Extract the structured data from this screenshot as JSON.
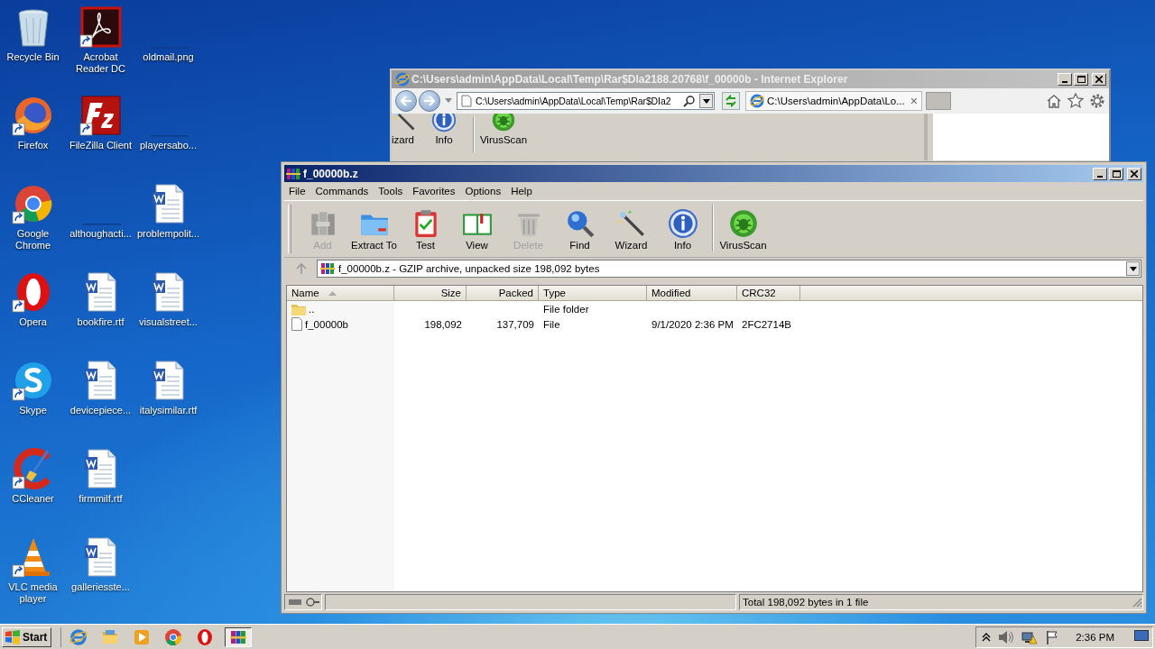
{
  "desktop": {
    "icons": [
      {
        "label": "Recycle Bin",
        "kind": "recycle",
        "shortcut": false
      },
      {
        "label": "Firefox",
        "kind": "firefox",
        "shortcut": true
      },
      {
        "label": "Google Chrome",
        "kind": "chrome",
        "shortcut": true
      },
      {
        "label": "Opera",
        "kind": "opera",
        "shortcut": true
      },
      {
        "label": "Skype",
        "kind": "skype",
        "shortcut": true
      },
      {
        "label": "CCleaner",
        "kind": "ccleaner",
        "shortcut": true
      },
      {
        "label": "VLC media player",
        "kind": "vlc",
        "shortcut": true
      },
      {
        "label": "Acrobat Reader DC",
        "kind": "acrobat",
        "shortcut": true
      },
      {
        "label": "FileZilla Client",
        "kind": "filezilla",
        "shortcut": true
      },
      {
        "label": "althoughacti...",
        "kind": "blank",
        "shortcut": false
      },
      {
        "label": "bookfire.rtf",
        "kind": "word",
        "shortcut": false
      },
      {
        "label": "devicepiece...",
        "kind": "word",
        "shortcut": false
      },
      {
        "label": "firmmilf.rtf",
        "kind": "word",
        "shortcut": false
      },
      {
        "label": "galleriesste...",
        "kind": "word",
        "shortcut": false
      },
      {
        "label": "oldmail.png",
        "kind": "blank",
        "shortcut": false
      },
      {
        "label": "playersabo...",
        "kind": "blank",
        "shortcut": false
      },
      {
        "label": "problempolit...",
        "kind": "word",
        "shortcut": false
      },
      {
        "label": "visualstreet...",
        "kind": "word",
        "shortcut": false
      },
      {
        "label": "italysimilar.rtf",
        "kind": "word",
        "shortcut": false
      }
    ]
  },
  "ie_window": {
    "title": "C:\\Users\\admin\\AppData\\Local\\Temp\\Rar$DIa2188.20768\\f_00000b - Internet Explorer",
    "address": "C:\\Users\\admin\\AppData\\Local\\Temp\\Rar$DIa2",
    "tab": {
      "label": "C:\\Users\\admin\\AppData\\Lo...",
      "close": "×"
    },
    "content_items": [
      {
        "label": "izard",
        "kind": "wizard"
      },
      {
        "label": "Info",
        "kind": "info"
      },
      {
        "label": "VirusScan",
        "kind": "virusscan"
      }
    ]
  },
  "winrar": {
    "title": "f_00000b.z",
    "menu": [
      "File",
      "Commands",
      "Tools",
      "Favorites",
      "Options",
      "Help"
    ],
    "toolbar": [
      {
        "label": "Add",
        "kind": "add",
        "disabled": true
      },
      {
        "label": "Extract To",
        "kind": "extract",
        "disabled": false
      },
      {
        "label": "Test",
        "kind": "test",
        "disabled": false
      },
      {
        "label": "View",
        "kind": "view",
        "disabled": false
      },
      {
        "label": "Delete",
        "kind": "delete",
        "disabled": true
      },
      {
        "label": "Find",
        "kind": "find",
        "disabled": false
      },
      {
        "label": "Wizard",
        "kind": "wizard",
        "disabled": false
      },
      {
        "label": "Info",
        "kind": "info",
        "disabled": false
      },
      {
        "label": "VirusScan",
        "kind": "virusscan",
        "disabled": false
      }
    ],
    "path": "f_00000b.z - GZIP archive, unpacked size 198,092 bytes",
    "columns": [
      {
        "label": "Name",
        "sorted": true
      },
      {
        "label": "Size",
        "sorted": false
      },
      {
        "label": "Packed",
        "sorted": false
      },
      {
        "label": "Type",
        "sorted": false
      },
      {
        "label": "Modified",
        "sorted": false
      },
      {
        "label": "CRC32",
        "sorted": false
      }
    ],
    "rows": [
      {
        "kind": "folder",
        "name": "..",
        "type": "File folder"
      },
      {
        "kind": "file",
        "name": "f_00000b",
        "size": "198,092",
        "packed": "137,709",
        "type": "File",
        "modified": "9/1/2020 2:36 PM",
        "crc32": "2FC2714B"
      }
    ],
    "status": "Total 198,092 bytes in 1 file"
  },
  "taskbar": {
    "start": "Start",
    "apps": [
      {
        "kind": "ie",
        "selected": false
      },
      {
        "kind": "explorer",
        "selected": false
      },
      {
        "kind": "media",
        "selected": false
      },
      {
        "kind": "chrome",
        "selected": false
      },
      {
        "kind": "opera",
        "selected": false
      },
      {
        "kind": "winrar",
        "selected": true
      }
    ],
    "clock": "2:36 PM"
  }
}
